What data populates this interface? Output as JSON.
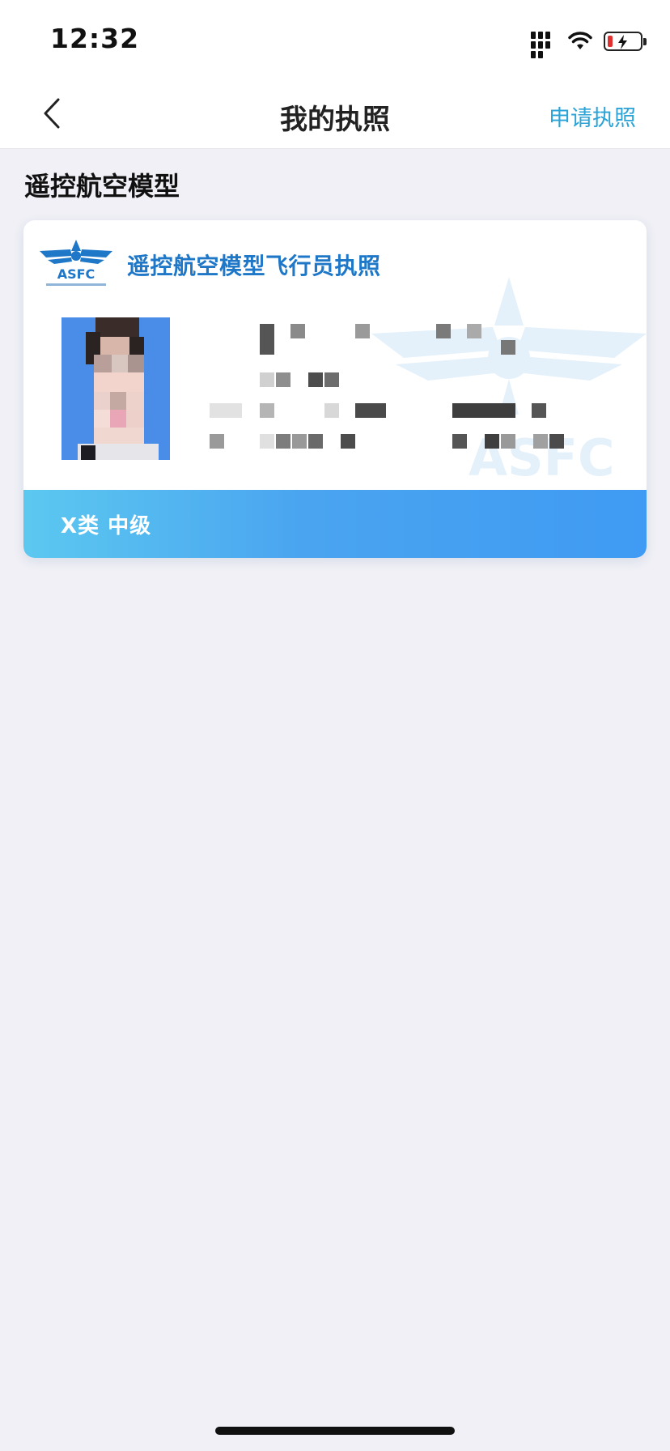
{
  "status_bar": {
    "time": "12:32",
    "battery_level_fraction": 0.15,
    "battery_charging": true
  },
  "nav": {
    "back_icon": "chevron-left-icon",
    "title": "我的执照",
    "apply_label": "申请执照"
  },
  "section": {
    "title": "遥控航空模型"
  },
  "license_card": {
    "logo_text": "ASFC",
    "title": "遥控航空模型飞行员执照",
    "watermark_text": "ASFC",
    "level": "X类 中级"
  },
  "colors": {
    "link": "#2ba3d6",
    "card_title": "#1f77c8",
    "footer_gradient_start": "#5cc8f0",
    "footer_gradient_end": "#3f9bf3",
    "page_background": "#f0f0f6"
  }
}
